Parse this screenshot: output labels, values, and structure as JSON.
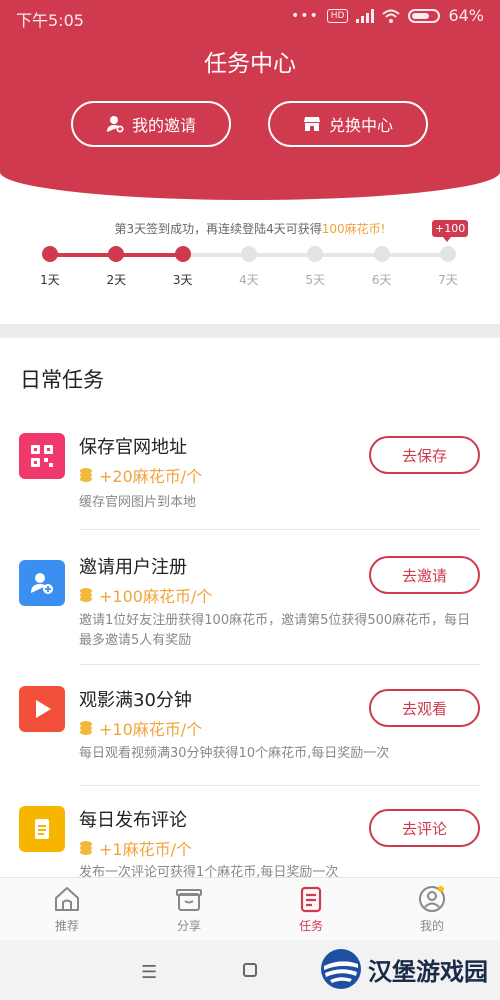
{
  "status": {
    "time": "下午5:05",
    "battery": "64%",
    "signal_dots": "•••",
    "hd": "HD"
  },
  "header": {
    "title": "任务中心",
    "invite_label": "我的邀请",
    "exchange_label": "兑换中心"
  },
  "checkin": {
    "message_prefix": "第3天签到成功，再连续登陆4天可获得",
    "message_highlight": "100麻花币!",
    "bonus_badge": "+100",
    "progress_days_completed": 3,
    "days": [
      "1天",
      "2天",
      "3天",
      "4天",
      "5天",
      "6天",
      "7天"
    ]
  },
  "daily": {
    "title": "日常任务",
    "tasks": [
      {
        "name": "保存官网地址",
        "reward": "+20麻花币/个",
        "desc": "缓存官网图片到本地",
        "button": "去保存",
        "icon": "qr-code-icon",
        "color": "#f0386b"
      },
      {
        "name": "邀请用户注册",
        "reward": "+100麻花币/个",
        "desc": "邀请1位好友注册获得100麻花币，邀请第5位获得500麻花币，每日最多邀请5人有奖励",
        "button": "去邀请",
        "icon": "add-user-icon",
        "color": "#3a8ff0"
      },
      {
        "name": "观影满30分钟",
        "reward": "+10麻花币/个",
        "desc": "每日观看视频满30分钟获得10个麻花币,每日奖励一次",
        "button": "去观看",
        "icon": "play-icon",
        "color": "#f2503a"
      },
      {
        "name": "每日发布评论",
        "reward": "+1麻花币/个",
        "desc": "发布一次评论可获得1个麻花币,每日奖励一次",
        "button": "去评论",
        "icon": "document-icon",
        "color": "#f7b500"
      }
    ]
  },
  "tabs": [
    {
      "label": "推荐",
      "icon": "home-icon"
    },
    {
      "label": "分享",
      "icon": "gift-box-icon"
    },
    {
      "label": "任务",
      "icon": "task-icon"
    },
    {
      "label": "我的",
      "icon": "profile-icon"
    }
  ],
  "watermark": {
    "text": "汉堡游戏园"
  },
  "colors": {
    "brand": "#cf3a4f",
    "accent": "#f1a33b"
  }
}
